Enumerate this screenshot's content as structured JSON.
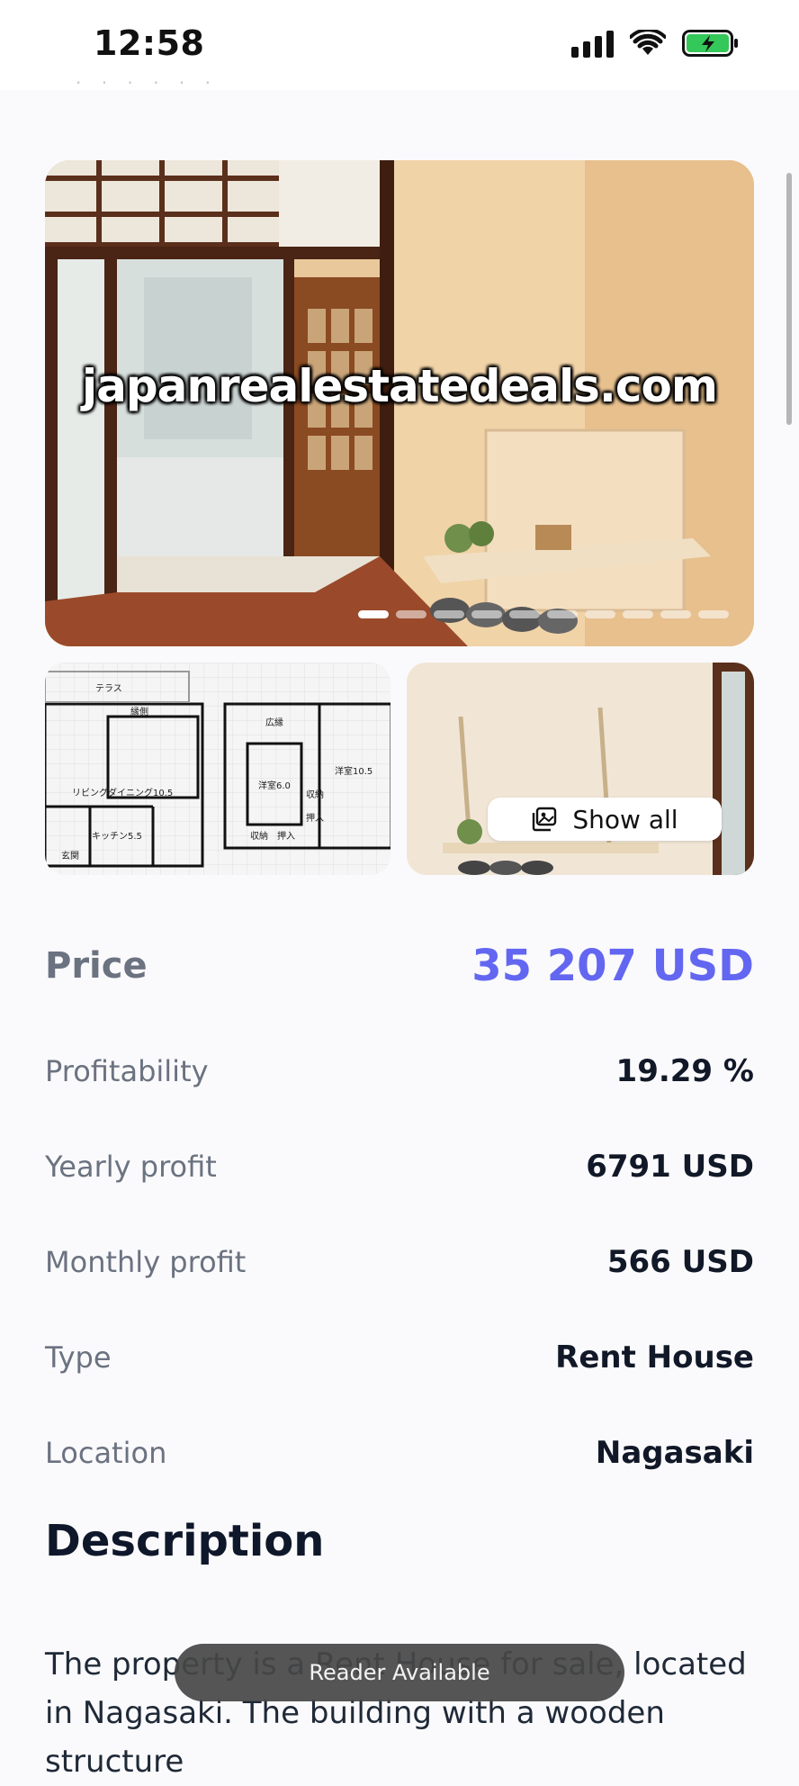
{
  "status_bar": {
    "time": "12:58"
  },
  "gallery": {
    "watermark": "japanrealestatedeals.com",
    "show_all_label": "Show all",
    "slide_count": 10,
    "active_slide": 1,
    "floorplan_labels": {
      "terrace": "テラス",
      "engawa": "縁側",
      "living": "リビングダイニング10.5",
      "kitchen": "キッチン5.5",
      "entrance": "玄関",
      "hall": "広縁",
      "western1": "洋室6.0",
      "western2": "洋室10.5",
      "storage1": "収納",
      "storage2": "収納",
      "closet": "押入",
      "closet2": "押入"
    }
  },
  "details": {
    "price": {
      "label": "Price",
      "value": "35 207 USD"
    },
    "profitability": {
      "label": "Profitability",
      "value": "19.29 %"
    },
    "yearly_profit": {
      "label": "Yearly profit",
      "value": "6791 USD"
    },
    "monthly_profit": {
      "label": "Monthly profit",
      "value": "566 USD"
    },
    "type": {
      "label": "Type",
      "value": "Rent House"
    },
    "location": {
      "label": "Location",
      "value": "Nagasaki"
    }
  },
  "description": {
    "title": "Description",
    "text": "The property is a Rent House for sale, located in Nagasaki. The building with a wooden structure"
  },
  "reader": {
    "label": "Reader Available"
  },
  "colors": {
    "accent": "#6366f1",
    "label_gray": "#6b7280"
  }
}
